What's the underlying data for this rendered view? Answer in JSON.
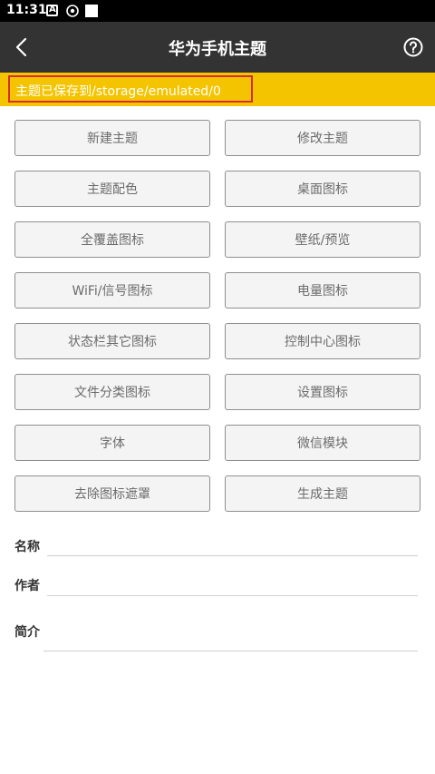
{
  "status_bar": {
    "time": "11:31",
    "icons": [
      "a-icon",
      "eye-icon",
      "notification-square-icon"
    ]
  },
  "app_bar": {
    "title": "华为手机主题",
    "back_icon": "chevron-left-icon",
    "help_icon": "help-circle-icon"
  },
  "notice": {
    "text": "主题已保存到/storage/emulated/0"
  },
  "buttons": [
    "新建主题",
    "修改主题",
    "主题配色",
    "桌面图标",
    "全覆盖图标",
    "壁纸/预览",
    "WiFi/信号图标",
    "电量图标",
    "状态栏其它图标",
    "控制中心图标",
    "文件分类图标",
    "设置图标",
    "字体",
    "微信模块",
    "去除图标遮罩",
    "生成主题"
  ],
  "form": {
    "name_label": "名称",
    "author_label": "作者",
    "intro_label": "简介",
    "name_value": "",
    "author_value": "",
    "intro_value": ""
  },
  "colors": {
    "app_bar": "#333333",
    "notice": "#f5c400",
    "highlight_border": "#d32f2f",
    "button_bg": "#f4f4f4"
  }
}
